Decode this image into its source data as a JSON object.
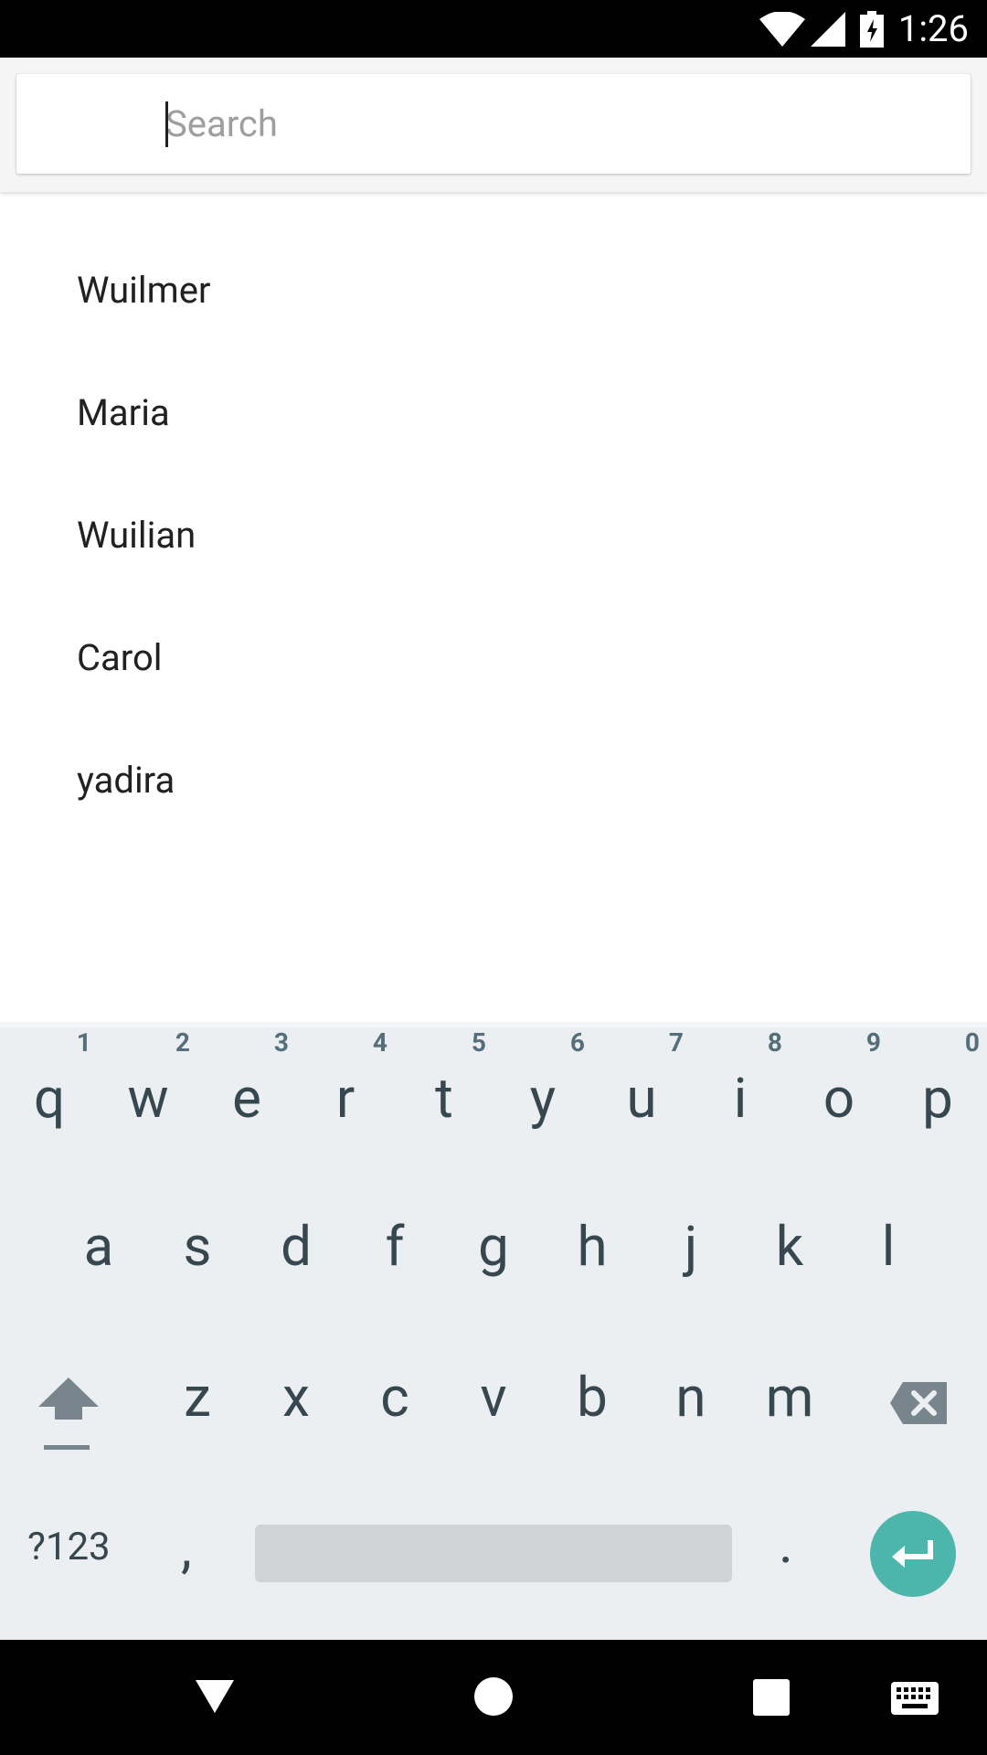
{
  "status_bar": {
    "time": "1:26",
    "icons": [
      "wifi-icon",
      "signal-icon",
      "battery-charging-icon"
    ]
  },
  "search": {
    "placeholder": "Search",
    "value": ""
  },
  "results": [
    "Wuilmer",
    "Maria",
    "Wuilian",
    "Carol",
    "yadira"
  ],
  "keyboard": {
    "row1": [
      {
        "key": "q",
        "hint": "1"
      },
      {
        "key": "w",
        "hint": "2"
      },
      {
        "key": "e",
        "hint": "3"
      },
      {
        "key": "r",
        "hint": "4"
      },
      {
        "key": "t",
        "hint": "5"
      },
      {
        "key": "y",
        "hint": "6"
      },
      {
        "key": "u",
        "hint": "7"
      },
      {
        "key": "i",
        "hint": "8"
      },
      {
        "key": "o",
        "hint": "9"
      },
      {
        "key": "p",
        "hint": "0"
      }
    ],
    "row2": [
      "a",
      "s",
      "d",
      "f",
      "g",
      "h",
      "j",
      "k",
      "l"
    ],
    "row3": [
      "z",
      "x",
      "c",
      "v",
      "b",
      "n",
      "m"
    ],
    "symbols_label": "?123",
    "comma_label": ",",
    "period_label": ".",
    "accent_color": "#4db6ac"
  },
  "nav_bar": {
    "buttons": [
      "back-icon",
      "home-icon",
      "recents-icon",
      "keyboard-switch-icon"
    ]
  }
}
